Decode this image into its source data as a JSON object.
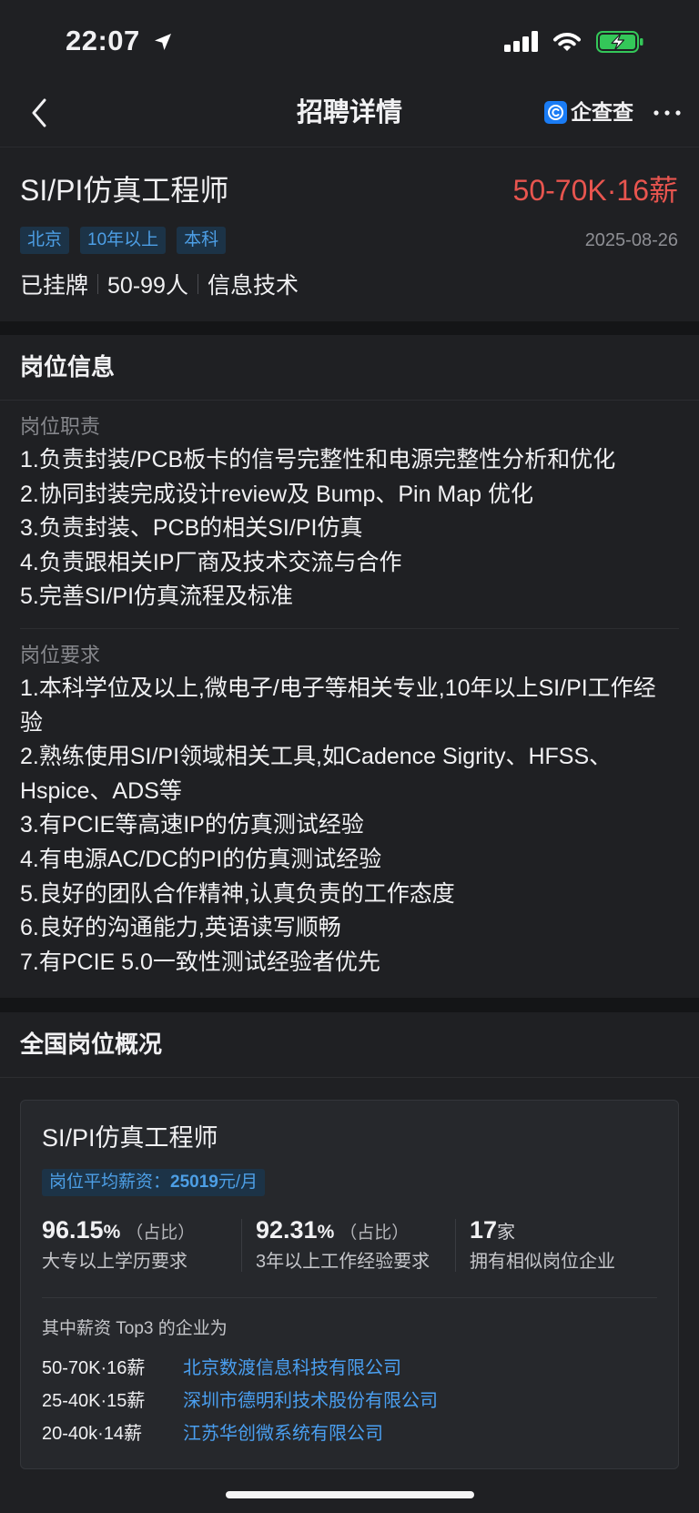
{
  "status_bar": {
    "time": "22:07"
  },
  "nav": {
    "title": "招聘详情",
    "brand": "企查查"
  },
  "job": {
    "title": "SI/PI仿真工程师",
    "salary": "50-70K·16薪",
    "tags": [
      "北京",
      "10年以上",
      "本科"
    ],
    "date": "2025-08-26",
    "company_info": [
      "已挂牌",
      "50-99人",
      "信息技术"
    ]
  },
  "info": {
    "heading": "岗位信息",
    "duties": {
      "label": "岗位职责",
      "items": [
        "1.负责封装/PCB板卡的信号完整性和电源完整性分析和优化",
        "2.协同封装完成设计review及 Bump、Pin Map 优化",
        "3.负责封装、PCB的相关SI/PI仿真",
        "4.负责跟相关IP厂商及技术交流与合作",
        "5.完善SI/PI仿真流程及标准"
      ]
    },
    "requirements": {
      "label": "岗位要求",
      "items": [
        "1.本科学位及以上,微电子/电子等相关专业,10年以上SI/PI工作经验",
        "2.熟练使用SI/PI领域相关工具,如Cadence Sigrity、HFSS、Hspice、ADS等",
        "3.有PCIE等高速IP的仿真测试经验",
        "4.有电源AC/DC的PI的仿真测试经验",
        "5.良好的团队合作精神,认真负责的工作态度",
        "6.良好的沟通能力,英语读写顺畅",
        "7.有PCIE 5.0一致性测试经验者优先"
      ]
    }
  },
  "overview": {
    "heading": "全国岗位概况",
    "card": {
      "title": "SI/PI仿真工程师",
      "avg_salary": {
        "label": "岗位平均薪资：",
        "value": "25019",
        "unit": "元/月"
      },
      "stats": [
        {
          "value": "96.15",
          "unit": "%",
          "note": "（占比）",
          "desc": "大专以上学历要求"
        },
        {
          "value": "92.31",
          "unit": "%",
          "note": "（占比）",
          "desc": "3年以上工作经验要求"
        },
        {
          "value": "17",
          "unit": "家",
          "desc": "拥有相似岗位企业"
        }
      ],
      "top_label": "其中薪资 Top3 的企业为",
      "top_companies": [
        {
          "salary": "50-70K·16薪",
          "name": "北京数渡信息科技有限公司"
        },
        {
          "salary": "25-40K·15薪",
          "name": "深圳市德明利技术股份有限公司"
        },
        {
          "salary": "20-40k·14薪",
          "name": "江苏华创微系统有限公司"
        }
      ]
    }
  },
  "icons": {
    "back": "chevron-left-icon",
    "brand": "qichacha-logo-icon",
    "more": "more-dots-icon",
    "location": "location-arrow-icon",
    "signal": "cellular-signal-icon",
    "wifi": "wifi-icon",
    "battery": "battery-charging-icon"
  },
  "colors": {
    "salary": "#e8554f",
    "link": "#4a9ff0",
    "tag_bg": "#1c3347",
    "tag_text": "#4d9fe6",
    "battery": "#34c759",
    "brand": "#1a7cf5",
    "background": "#1f2023"
  }
}
